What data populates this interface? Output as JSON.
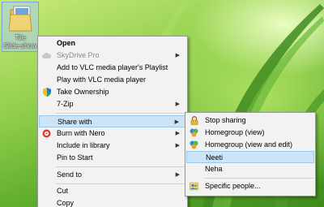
{
  "desktop_icon": {
    "label": "Tile\nSlide-show"
  },
  "context_menu": {
    "items": [
      {
        "label": "Open",
        "icon": "none"
      },
      {
        "label": "SkyDrive Pro",
        "icon": "cloud-icon"
      },
      {
        "label": "Add to VLC media player's Playlist",
        "icon": "none"
      },
      {
        "label": "Play with VLC media player",
        "icon": "none"
      },
      {
        "label": "Take Ownership",
        "icon": "uac-shield-icon"
      },
      {
        "label": "7-Zip",
        "icon": "none"
      },
      {
        "label": "Share with",
        "icon": "none"
      },
      {
        "label": "Burn with Nero",
        "icon": "nero-icon"
      },
      {
        "label": "Include in library",
        "icon": "none"
      },
      {
        "label": "Pin to Start",
        "icon": "none"
      },
      {
        "label": "Send to",
        "icon": "none"
      },
      {
        "label": "Cut",
        "icon": "none"
      },
      {
        "label": "Copy",
        "icon": "none"
      }
    ]
  },
  "share_submenu": {
    "items": [
      {
        "label": "Stop sharing",
        "icon": "lock-icon"
      },
      {
        "label": "Homegroup (view)",
        "icon": "homegroup-icon"
      },
      {
        "label": "Homegroup (view and edit)",
        "icon": "homegroup-icon"
      },
      {
        "label": "Neeti",
        "icon": "none"
      },
      {
        "label": "Neha",
        "icon": "none"
      },
      {
        "label": "Specific people...",
        "icon": "people-icon"
      }
    ]
  },
  "colors": {
    "highlight_bg": "#cce4f7",
    "highlight_border": "#99c9ef",
    "menu_bg": "#f2f2f2",
    "wallpaper_green": "#7dc242"
  }
}
